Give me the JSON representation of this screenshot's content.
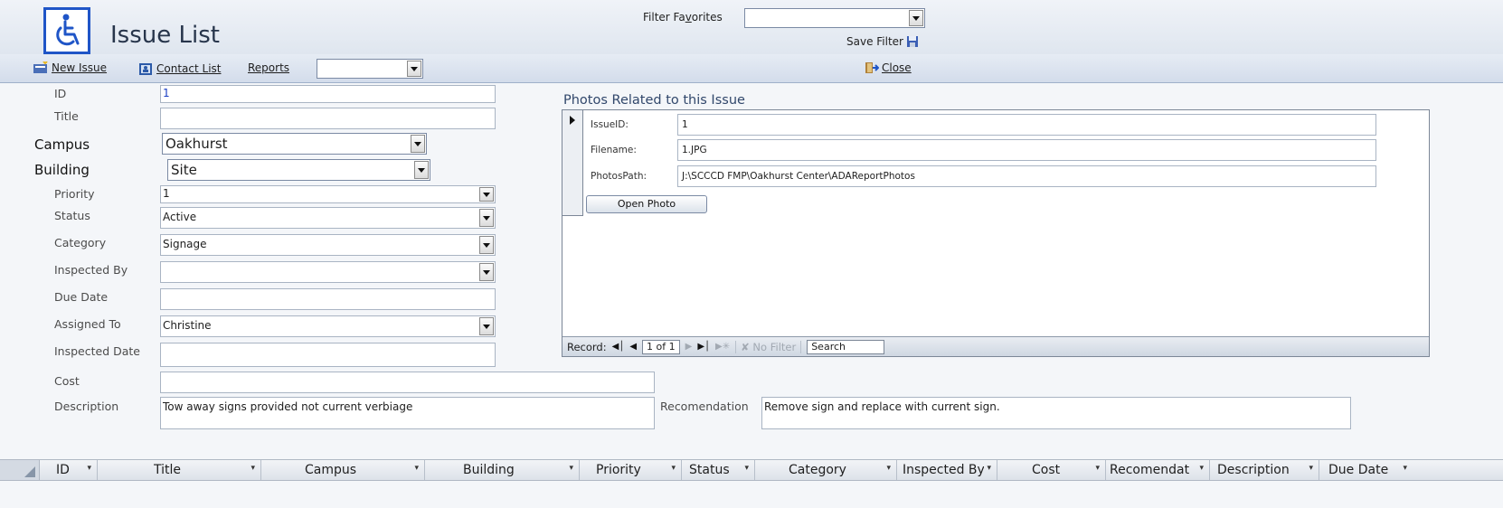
{
  "header": {
    "title": "Issue List",
    "filter_favorites_label": "Filter Favorites",
    "filter_favorites_value": "",
    "save_filter_label": "Save Filter"
  },
  "toolbar": {
    "new_issue": "New Issue",
    "contact_list": "Contact List",
    "reports": "Reports",
    "reports_value": "",
    "close": "Close"
  },
  "form": {
    "id_label": "ID",
    "id_value": "1",
    "title_label": "Title",
    "title_value": "",
    "campus_label": "Campus",
    "campus_value": "Oakhurst",
    "building_label": "Building",
    "building_value": "Site",
    "priority_label": "Priority",
    "priority_value": "1",
    "status_label": "Status",
    "status_value": "Active",
    "category_label": "Category",
    "category_value": "Signage",
    "inspected_by_label": "Inspected By",
    "inspected_by_value": "",
    "due_date_label": "Due Date",
    "due_date_value": "",
    "assigned_to_label": "Assigned To",
    "assigned_to_value": "Christine",
    "inspected_date_label": "Inspected Date",
    "inspected_date_value": "",
    "cost_label": "Cost",
    "cost_value": "",
    "description_label": "Description",
    "description_value": "Tow away signs provided not current verbiage",
    "recommendation_label": "Recomendation",
    "recommendation_value": "Remove sign and replace with current sign."
  },
  "photos": {
    "title": "Photos Related to this Issue",
    "issueid_label": "IssueID:",
    "issueid_value": "1",
    "filename_label": "Filename:",
    "filename_value": "1.JPG",
    "photospath_label": "PhotosPath:",
    "photospath_value": "J:\\SCCCD FMP\\Oakhurst Center\\ADAReportPhotos",
    "open_photo": "Open Photo",
    "nav": {
      "record_label": "Record:",
      "position": "1 of 1",
      "no_filter": "No Filter",
      "search": "Search"
    }
  },
  "datasheet": {
    "columns": [
      "ID",
      "Title",
      "Campus",
      "Building",
      "Priority",
      "Status",
      "Category",
      "Inspected By",
      "Cost",
      "Recomendat",
      "Description",
      "Due Date"
    ]
  },
  "colors": {
    "accent": "#1f55c7",
    "toolbar": "#d3dceb",
    "background": "#f4f6f9"
  }
}
